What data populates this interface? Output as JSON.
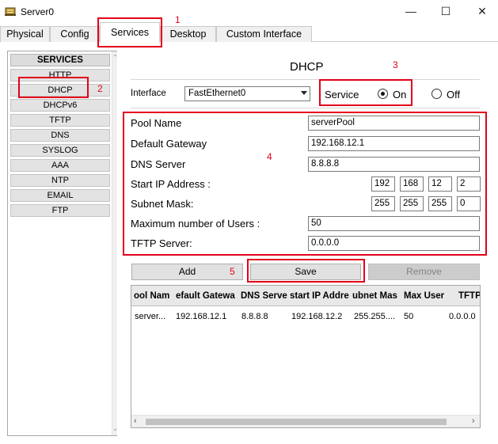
{
  "window": {
    "title": "Server0",
    "minimize": "—",
    "maximize": "☐",
    "close": "✕"
  },
  "tabs": [
    "Physical",
    "Config",
    "Services",
    "Desktop",
    "Custom Interface"
  ],
  "services": {
    "header": "SERVICES",
    "items": [
      "HTTP",
      "DHCP",
      "DHCPv6",
      "TFTP",
      "DNS",
      "SYSLOG",
      "AAA",
      "NTP",
      "EMAIL",
      "FTP"
    ]
  },
  "dhcp": {
    "title": "DHCP",
    "interface_label": "Interface",
    "interface_value": "FastEthernet0",
    "service_label": "Service",
    "on_label": "On",
    "off_label": "Off",
    "service_state": "On",
    "fields": {
      "pool_name_label": "Pool Name",
      "pool_name": "serverPool",
      "gateway_label": "Default Gateway",
      "gateway": "192.168.12.1",
      "dns_label": "DNS Server",
      "dns": "8.8.8.8",
      "start_ip_label": "Start IP Address :",
      "start_ip": [
        "192",
        "168",
        "12",
        "2"
      ],
      "subnet_label": "Subnet Mask:",
      "subnet": [
        "255",
        "255",
        "255",
        "0"
      ],
      "max_users_label": "Maximum number of Users :",
      "max_users": "50",
      "tftp_label": "TFTP Server:",
      "tftp": "0.0.0.0"
    },
    "buttons": {
      "add": "Add",
      "save": "Save",
      "remove": "Remove"
    },
    "table": {
      "headers": [
        "ool Nam",
        "efault Gatewa",
        "DNS Serve",
        "start IP Addre",
        "ubnet Mas",
        "Max User",
        "TFTP"
      ],
      "rows": [
        [
          "server...",
          "192.168.12.1",
          "8.8.8.8",
          "192.168.12.2",
          "255.255....",
          "50",
          "0.0.0.0"
        ]
      ]
    }
  },
  "annotations": [
    "1",
    "2",
    "3",
    "4",
    "5"
  ],
  "colors": {
    "annotation": "#e3001b"
  }
}
